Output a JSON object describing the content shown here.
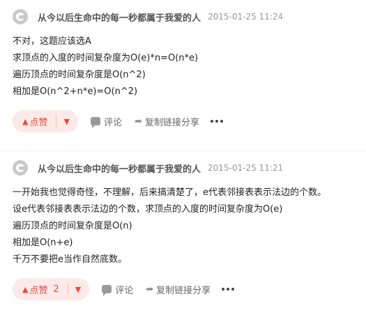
{
  "comments": [
    {
      "username": "从今以后生命中的每一秒都属于我爱的人",
      "date": "2015-01-25 11:24",
      "lines": [
        "不对，这题应该选A",
        "求顶点的入度的时间复杂度为O(e)*n=O(n*e)",
        "遍历顶点的时间复杂度是O(n^2)",
        "相加是O(n^2+n*e)=O(n^2)"
      ],
      "like_label": "点赞",
      "like_count": "",
      "comment_label": "评论",
      "share_label": "复制链接分享"
    },
    {
      "username": "从今以后生命中的每一秒都属于我爱的人",
      "date": "2015-01-25 11:21",
      "lines": [
        "一开始我也觉得奇怪，不理解，后来搞清楚了，e代表邻接表表示法边的个数。",
        "设e代表邻接表表示法边的个数，求顶点的入度的时间复杂度为O(e)",
        "遍历顶点的时间复杂度是O(n)",
        "相加是O(n+e)",
        "千万不要把e当作自然底数。"
      ],
      "like_label": "点赞",
      "like_count": "2",
      "comment_label": "评论",
      "share_label": "复制链接分享"
    }
  ],
  "colors": {
    "accent": "#e74c3c",
    "vote_bg": "#fde9e8",
    "muted": "#999999"
  },
  "icons": {
    "avatar": "avatar-icon",
    "upvote": "up-triangle-icon",
    "downvote": "down-triangle-icon",
    "comment": "chat-bubble-icon",
    "share": "share-arrow-icon",
    "more": "more-dots-icon"
  }
}
